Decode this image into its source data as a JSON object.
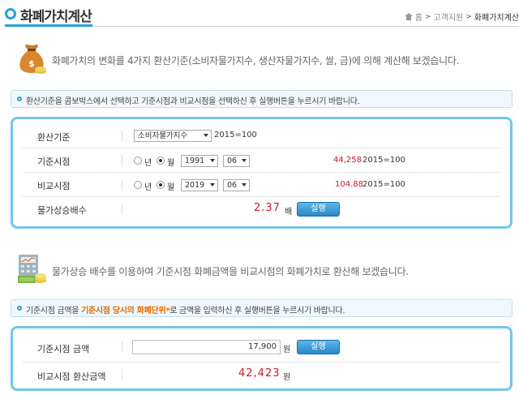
{
  "header": {
    "title": "화폐가치계산",
    "breadcrumb": [
      "홈",
      "고객지원",
      "화폐가치계산"
    ]
  },
  "section1": {
    "intro": "화폐가치의 변화를 4가지 환산기준(소비자물가지수, 생산자물가지수, 쌀, 금)에 의해 계산해 보겠습니다.",
    "notice": "환산기준을 콤보박스에서 선택하고 기준시점과 비교시점을 선택하신 후 실행버튼을 누르시기 바랍니다.",
    "basis": {
      "label": "환산기준",
      "selected": "소비자물가지수",
      "base_text": "2015=100"
    },
    "base_point": {
      "label": "기준시점",
      "radio_year": "년",
      "radio_month": "월",
      "year": "1991",
      "month": "06",
      "index_value": "44,258",
      "base_text": "2015=100"
    },
    "compare_point": {
      "label": "비교시점",
      "radio_year": "년",
      "radio_month": "월",
      "year": "2019",
      "month": "06",
      "index_value": "104.88",
      "base_text": "2015=100"
    },
    "multiplier": {
      "label": "물가상승배수",
      "value": "2.37",
      "unit": "배",
      "button": "실행"
    }
  },
  "section2": {
    "intro": "물가상승 배수를 이용하여 기준시점 화폐금액을 비교시점의 화폐가치로 환산해 보겠습니다.",
    "notice_pre": "기준시점 금액을 ",
    "notice_highlight": "기준시점 당시의 화폐단위*",
    "notice_post": "로 금액을 입력하신 후 실행버튼을 누르시기 바랍니다.",
    "base_amount": {
      "label": "기준시점 금액",
      "value": "17,900",
      "unit": "원",
      "button": "실행"
    },
    "converted_amount": {
      "label": "비교시점 환산금액",
      "value": "42,423",
      "unit": "원"
    }
  },
  "colors": {
    "accent": "#2a9fd8",
    "panel_border": "#74c6e9",
    "value_red": "#c8192a",
    "highlight": "#e26a00"
  },
  "icons": [
    "home-icon",
    "money-bag-icon",
    "calculator-coins-icon",
    "notice-bullet-icon",
    "title-circle-icon"
  ]
}
